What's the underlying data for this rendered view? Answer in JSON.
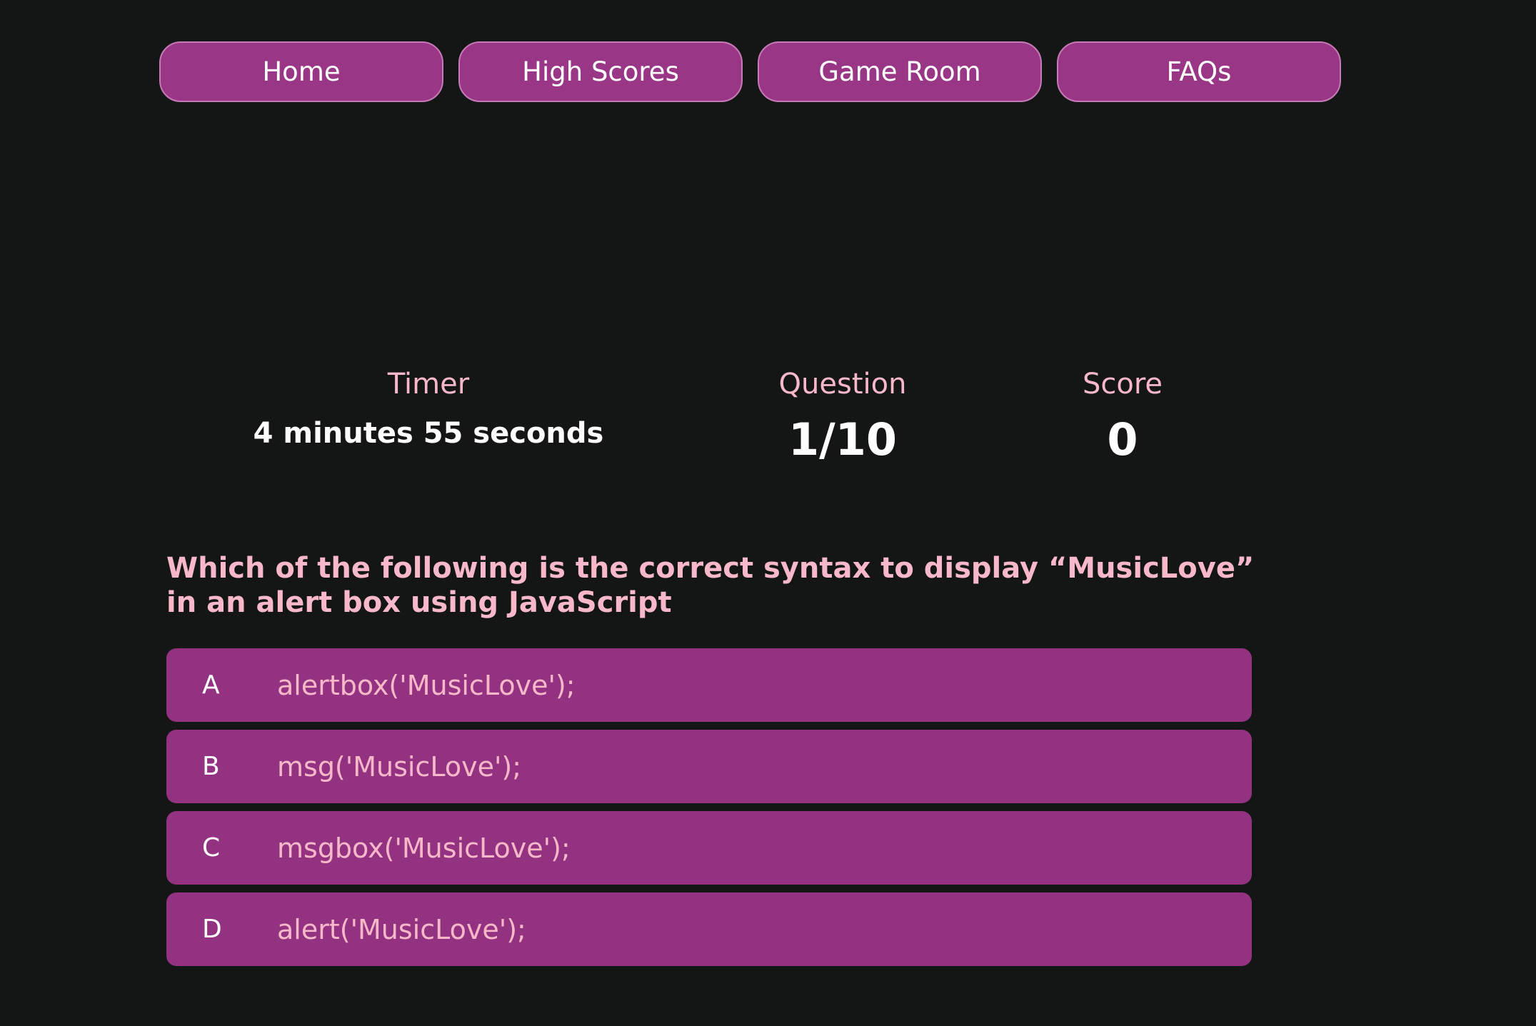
{
  "nav": {
    "items": [
      {
        "label": "Home"
      },
      {
        "label": "High Scores"
      },
      {
        "label": "Game Room"
      },
      {
        "label": "FAQs"
      }
    ]
  },
  "stats": {
    "timer": {
      "label": "Timer",
      "value": "4 minutes 55 seconds"
    },
    "question": {
      "label": "Question",
      "value": "1/10"
    },
    "score": {
      "label": "Score",
      "value": "0"
    }
  },
  "quiz": {
    "question": "Which of the following is the correct syntax to display “MusicLove” in an alert box using JavaScript",
    "answers": [
      {
        "letter": "A",
        "text": "alertbox('MusicLove');"
      },
      {
        "letter": "B",
        "text": "msg('MusicLove');"
      },
      {
        "letter": "C",
        "text": "msgbox('MusicLove');"
      },
      {
        "letter": "D",
        "text": "alert('MusicLove');"
      }
    ]
  },
  "colors": {
    "background": "#141515",
    "button": "#993686",
    "answer_bg": "#943282",
    "accent_text": "#f7b8c9",
    "text": "#ffffff"
  }
}
